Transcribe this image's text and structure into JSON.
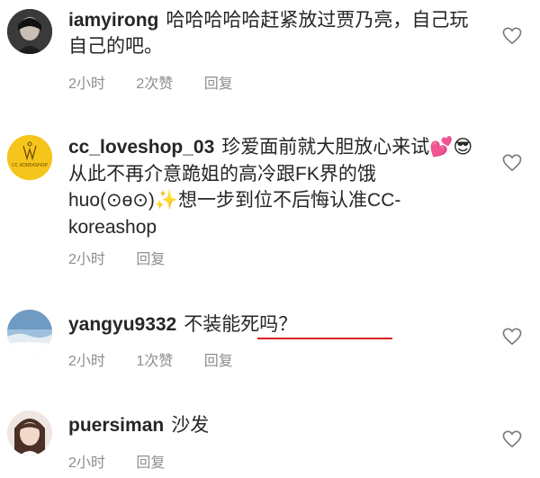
{
  "comments": [
    {
      "username": "iamyirong",
      "text": "哈哈哈哈哈赶紧放过贾乃亮，自己玩自己的吧。",
      "time": "2小时",
      "likes": "2次赞",
      "reply": "回复",
      "avatar_icon": "avatar-dark-portrait"
    },
    {
      "username": "cc_loveshop_03",
      "text": "珍爱面前就大胆放心来试💕😎从此不再介意跪姐的高冷跟FK界的饿huo(⊙ө⊙)✨想一步到位不后悔认准CC-koreashop",
      "time": "2小时",
      "reply": "回复",
      "avatar_icon": "avatar-yellow-logo",
      "avatar_text": "CC KOREASHOP"
    },
    {
      "username": "yangyu9332",
      "text": "不装能死吗？",
      "time": "2小时",
      "likes": "1次赞",
      "reply": "回复",
      "avatar_icon": "avatar-sky-landscape"
    },
    {
      "username": "puersiman",
      "text": "沙发",
      "time": "2小时",
      "reply": "回复",
      "avatar_icon": "avatar-girl-portrait"
    }
  ],
  "icons": {
    "like": "heart-outline-icon"
  },
  "colors": {
    "meta": "#8e8e8e",
    "underline": "#e02020",
    "avatar_yellow": "#f6c51b"
  }
}
